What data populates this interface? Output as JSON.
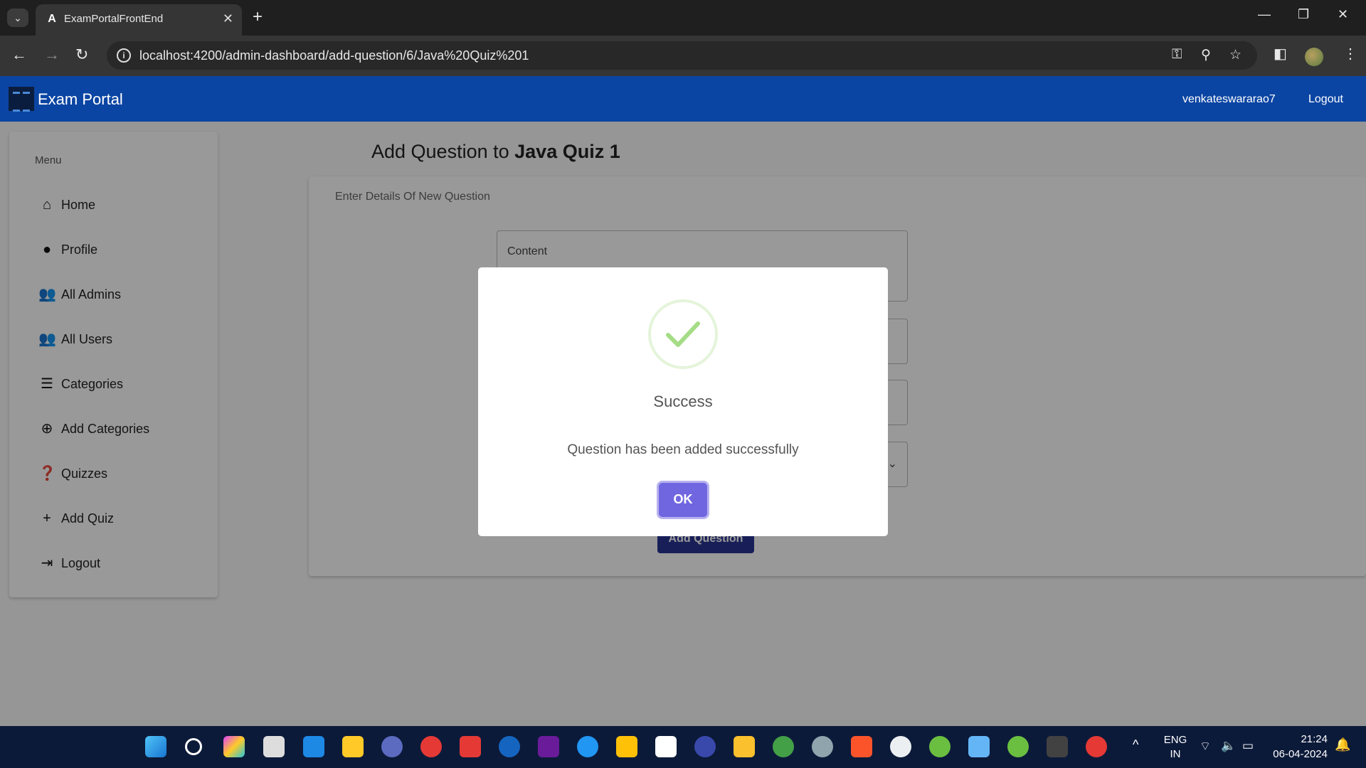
{
  "browser": {
    "tab_title": "ExamPortalFrontEnd",
    "tab_favicon": "A",
    "url": "localhost:4200/admin-dashboard/add-question/6/Java%20Quiz%201"
  },
  "header": {
    "brand": "Exam Portal",
    "username": "venkateswararao7",
    "logout": "Logout"
  },
  "sidebar": {
    "heading": "Menu",
    "items": [
      {
        "label": "Home",
        "icon": "home-icon"
      },
      {
        "label": "Profile",
        "icon": "account-circle-icon"
      },
      {
        "label": "All Admins",
        "icon": "people-icon"
      },
      {
        "label": "All Users",
        "icon": "people-icon"
      },
      {
        "label": "Categories",
        "icon": "list-icon"
      },
      {
        "label": "Add Categories",
        "icon": "add-circle-icon"
      },
      {
        "label": "Quizzes",
        "icon": "quiz-icon"
      },
      {
        "label": "Add Quiz",
        "icon": "plus-icon"
      },
      {
        "label": "Logout",
        "icon": "logout-icon"
      }
    ]
  },
  "main": {
    "title_prefix": "Add Question to ",
    "quiz_name": "Java Quiz 1",
    "card_subtitle": "Enter Details Of New Question",
    "content_placeholder": "Content",
    "add_button": "Add Question"
  },
  "dialog": {
    "title": "Success",
    "message": "Question has been added successfully",
    "ok": "OK",
    "icon": "success-check-icon",
    "accent": "#7066e0",
    "check_color": "#a5dc86"
  },
  "taskbar": {
    "lang_top": "ENG",
    "lang_bottom": "IN",
    "time": "21:24",
    "date": "06-04-2024"
  },
  "colors": {
    "appbar": "#0b45a3",
    "add_button": "#283593"
  }
}
